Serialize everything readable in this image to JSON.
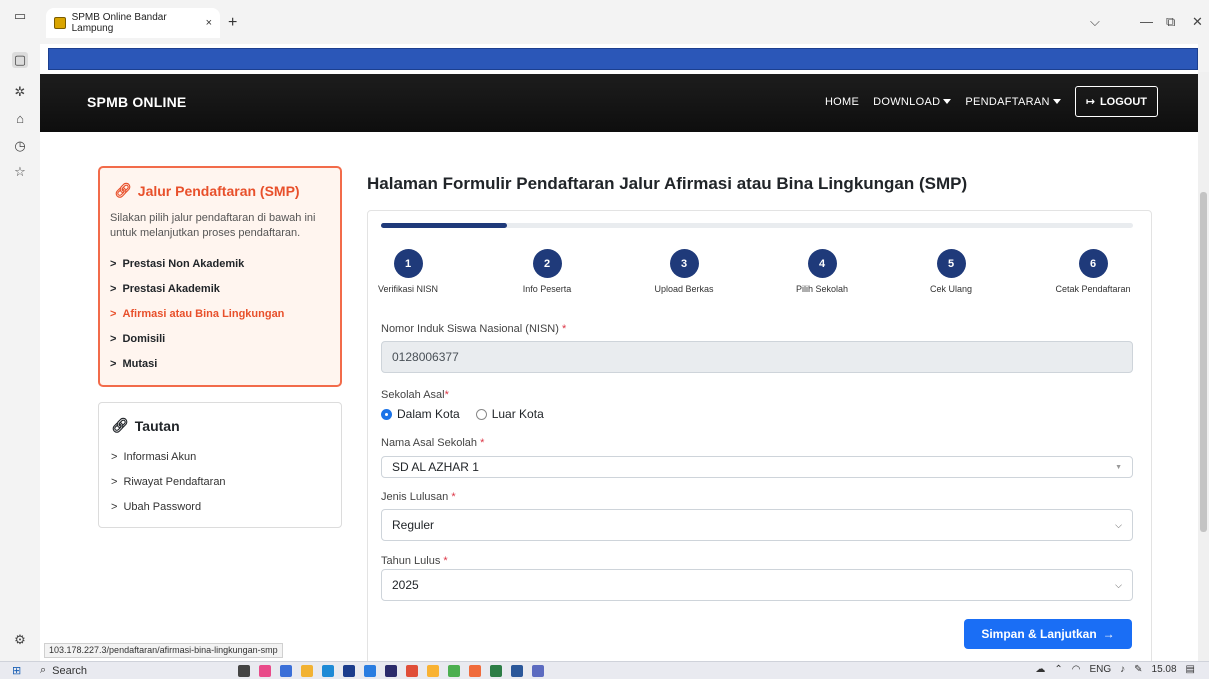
{
  "browser": {
    "tab_title": "SPMB Online Bandar Lampung",
    "tab_close": "×",
    "new_tab": "+",
    "status_url": "103.178.227.3/pendaftaran/afirmasi-bina-lingkungan-smp",
    "window_controls": [
      "⌵",
      "—",
      "⧉",
      "✕"
    ]
  },
  "navbar": {
    "brand": "SPMB ONLINE",
    "links": [
      "HOME",
      "DOWNLOAD",
      "PENDAFTARAN"
    ],
    "logout": "LOGOUT",
    "logout_icon": "↦"
  },
  "sidebar": {
    "jalur_title": "Jalur Pendaftaran (SMP)",
    "jalur_desc": "Silakan pilih jalur pendaftaran di bawah ini untuk melanjutkan proses pendaftaran.",
    "jalur_items": [
      "Prestasi Non Akademik",
      "Prestasi Akademik",
      "Afirmasi atau Bina Lingkungan",
      "Domisili",
      "Mutasi"
    ],
    "active_index": 2,
    "tautan_title": "Tautan",
    "tautan_items": [
      "Informasi Akun",
      "Riwayat Pendaftaran",
      "Ubah Password"
    ],
    "bullet": ">"
  },
  "main": {
    "title": "Halaman Formulir Pendaftaran Jalur Afirmasi atau Bina Lingkungan (SMP)",
    "progress_fraction": 0.167,
    "steps": [
      {
        "num": "1",
        "label": "Verifikasi NISN"
      },
      {
        "num": "2",
        "label": "Info Peserta"
      },
      {
        "num": "3",
        "label": "Upload Berkas"
      },
      {
        "num": "4",
        "label": "Pilih Sekolah"
      },
      {
        "num": "5",
        "label": "Cek Ulang"
      },
      {
        "num": "6",
        "label": "Cetak Pendaftaran"
      }
    ],
    "nisn_label": "Nomor Induk Siswa Nasional (NISN)",
    "nisn_value": "0128006377",
    "sekolah_asal_label": "Sekolah Asal",
    "radio_dalam": "Dalam Kota",
    "radio_luar": "Luar Kota",
    "nama_sekolah_label": "Nama Asal Sekolah",
    "nama_sekolah_value": "SD AL AZHAR 1",
    "jenis_label": "Jenis Lulusan",
    "jenis_value": "Reguler",
    "tahun_label": "Tahun Lulus",
    "tahun_value": "2025",
    "required_mark": "*",
    "save_button": "Simpan & Lanjutkan",
    "save_arrow": "→"
  },
  "taskbar": {
    "search": "Search",
    "time": "15.08",
    "tray_ime": "ENG"
  },
  "colors": {
    "accent_orange": "#e8502b",
    "step_navy": "#1f3a7a",
    "button_blue": "#1a6ef5",
    "navbar": "#111111",
    "top_band": "#2b57b8"
  }
}
